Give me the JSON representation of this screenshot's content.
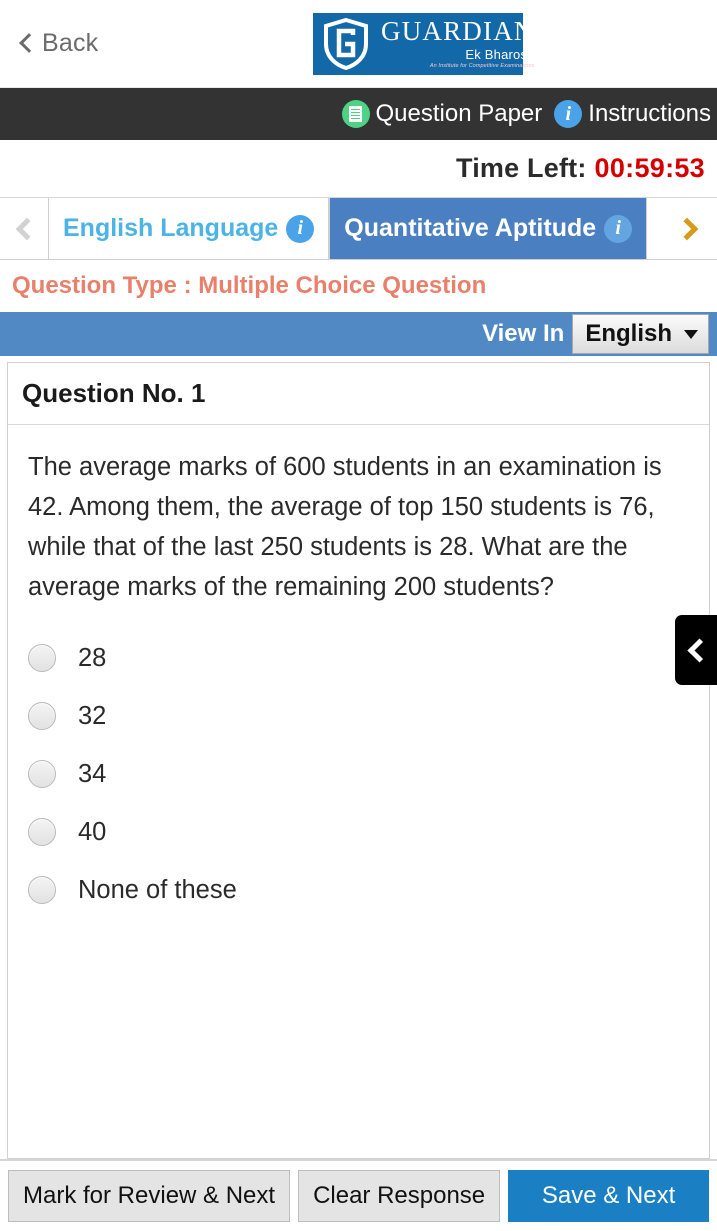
{
  "topbar": {
    "back_label": "Back",
    "back_icon": "chevron-left-icon",
    "logo": {
      "shield_letter": "G",
      "name": "GUARDIAN",
      "tagline": "Ek Bharosa",
      "subtagline": "An Institute for Competitive Examinations",
      "bg_color": "#1368a8"
    }
  },
  "darknav": {
    "bg_color": "#333333",
    "items": [
      {
        "label": "Question Paper",
        "icon": "question-paper-icon",
        "icon_color": "#4ed285"
      },
      {
        "label": "Instructions",
        "icon": "info-icon",
        "icon_color": "#4aa3e8"
      }
    ]
  },
  "timer": {
    "label": "Time Left:",
    "value": "00:59:53",
    "value_color": "#d40000"
  },
  "sections": {
    "prev_arrow_icon": "chevron-left-icon",
    "next_arrow_icon": "chevron-right-icon",
    "next_arrow_color": "#d69b1a",
    "tabs": [
      {
        "label": "English Language",
        "active": false,
        "info_icon": "info-icon"
      },
      {
        "label": "Quantitative Aptitude",
        "active": true,
        "info_icon": "info-icon"
      }
    ],
    "active_color": "#4a7fc1",
    "inactive_text_color": "#4cb3e6"
  },
  "question_type": {
    "text": "Question Type : Multiple Choice Question",
    "color": "#e8806b"
  },
  "view_in": {
    "label": "View In",
    "selected_language": "English",
    "caret_icon": "caret-down-icon",
    "bar_color": "#5089c4"
  },
  "question": {
    "number_label": "Question No. 1",
    "text": "The average marks of 600 students in an examination is 42. Among them, the average of top 150 students is 76, while that of the last 250 students is 28. What are the average marks of the remaining 200 students?",
    "options": [
      {
        "label": "28",
        "selected": false
      },
      {
        "label": "32",
        "selected": false
      },
      {
        "label": "34",
        "selected": false
      },
      {
        "label": "40",
        "selected": false
      },
      {
        "label": "None of these",
        "selected": false
      }
    ]
  },
  "side_panel_toggle": {
    "icon": "chevron-left-icon"
  },
  "footer": {
    "buttons": [
      {
        "label": "Mark for Review & Next",
        "style": "secondary"
      },
      {
        "label": "Clear Response",
        "style": "secondary"
      },
      {
        "label": "Save & Next",
        "style": "primary"
      }
    ],
    "primary_color": "#1b7fc4"
  }
}
